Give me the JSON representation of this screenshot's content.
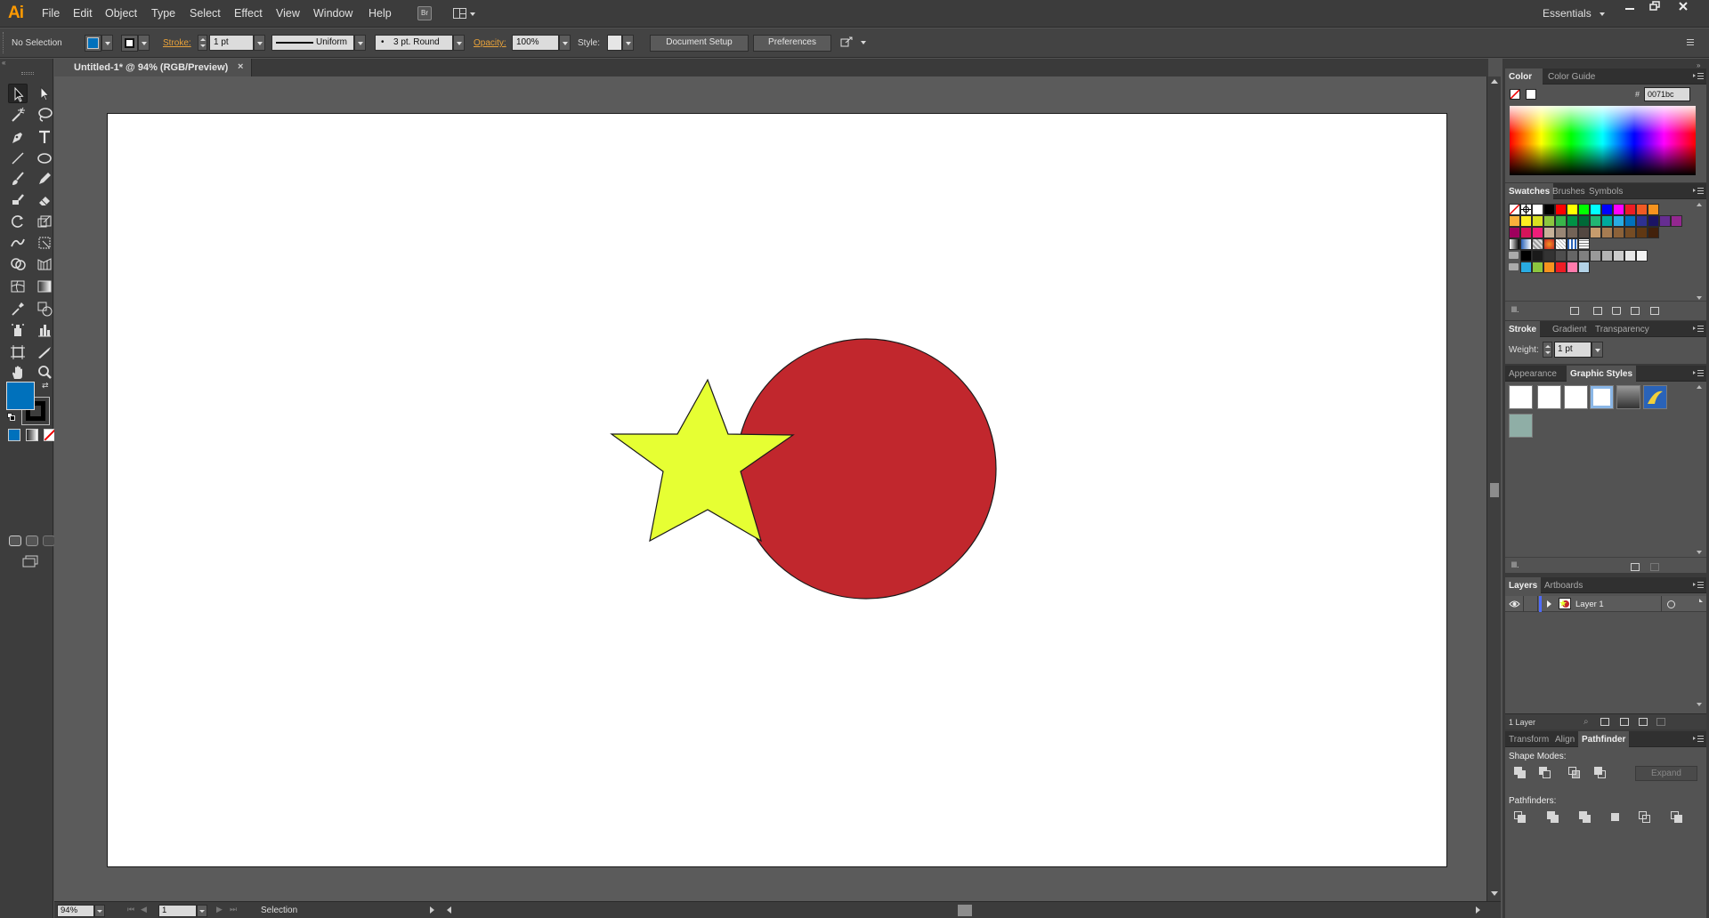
{
  "app": {
    "logo": "Ai",
    "menus": [
      "File",
      "Edit",
      "Object",
      "Type",
      "Select",
      "Effect",
      "View",
      "Window",
      "Help"
    ],
    "bridge_label": "Br",
    "workspace": "Essentials",
    "window_buttons": [
      "minimize-icon",
      "restore-icon",
      "close-icon"
    ]
  },
  "control": {
    "selection": "No Selection",
    "fill_color": "#0071bc",
    "stroke_label": "Stroke:",
    "stroke_weight": "1 pt",
    "profile": "Uniform",
    "brush": "3 pt. Round",
    "opacity_label": "Opacity:",
    "opacity": "100%",
    "style_label": "Style:",
    "doc_setup": "Document Setup",
    "preferences": "Preferences"
  },
  "document": {
    "tab_title": "Untitled-1* @ 94% (RGB/Preview)",
    "close": "×",
    "shapes": [
      {
        "type": "star",
        "fill": "#e6ff33",
        "stroke": "#1a1a1a"
      },
      {
        "type": "circle",
        "fill": "#c1272d",
        "stroke": "#1a1a1a"
      }
    ]
  },
  "status": {
    "zoom": "94%",
    "artboard": "1",
    "tool": "Selection"
  },
  "tools": {
    "fill_color": "#0071bc",
    "stroke_color": "#000000"
  },
  "panels": {
    "color": {
      "tabs": [
        "Color",
        "Color Guide"
      ],
      "hex_label": "#",
      "hex": "0071bc"
    },
    "swatches": {
      "tabs": [
        "Swatches",
        "Brushes",
        "Symbols"
      ],
      "row1": [
        "#ffffff",
        "#000000",
        "#ff0000",
        "#ffff00",
        "#00ff00",
        "#00ffff",
        "#0000ff",
        "#ff00ff",
        "#ed1c24",
        "#f15a24",
        "#f7931e"
      ],
      "row2": [
        "#fbb03b",
        "#fcee21",
        "#d9e021",
        "#8cc63f",
        "#39b54a",
        "#009245",
        "#006837",
        "#22b573",
        "#00a99d",
        "#29abe2",
        "#0071bc",
        "#2e3192",
        "#1b1464",
        "#662d91",
        "#93278f"
      ],
      "row3": [
        "#9e005d",
        "#d4145a",
        "#ed1e79",
        "#c7b299",
        "#998675",
        "#736357",
        "#534741",
        "#c69c6d",
        "#a67c52",
        "#8c6239",
        "#754c24",
        "#603813",
        "#42210b"
      ],
      "row5": [
        "#000000",
        "#1a1a1a",
        "#333333",
        "#4d4d4d",
        "#666666",
        "#808080",
        "#999999",
        "#b3b3b3",
        "#cccccc",
        "#e6e6e6",
        "#f2f2f2"
      ],
      "row6": [
        "#29abe2",
        "#8cc63f",
        "#f7931e",
        "#ed1c24",
        "#ff7bac",
        "#b3d2e6"
      ]
    },
    "stroke": {
      "tabs": [
        "Stroke",
        "Gradient",
        "Transparency"
      ],
      "weight_label": "Weight:",
      "weight": "1 pt"
    },
    "appearance": {
      "tabs": [
        "Appearance",
        "Graphic Styles"
      ]
    },
    "layers": {
      "tabs": [
        "Layers",
        "Artboards"
      ],
      "layer_name": "Layer 1",
      "count": "1 Layer"
    },
    "pathfinder": {
      "tabs": [
        "Transform",
        "Align",
        "Pathfinder"
      ],
      "shape_modes": "Shape Modes:",
      "expand": "Expand",
      "pathfinders": "Pathfinders:"
    }
  }
}
